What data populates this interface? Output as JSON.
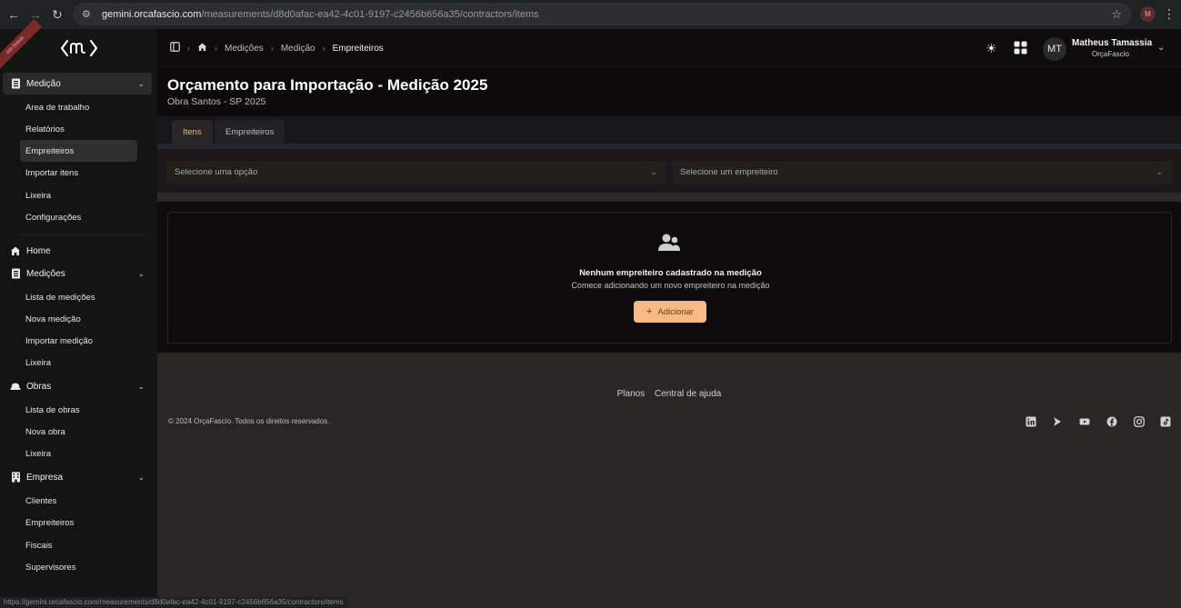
{
  "browser": {
    "url_host": "gemini.orcafascio.com",
    "url_path": "/measurements/d8d0afac-ea42-4c01-9197-c2456b656a35/contractors/items",
    "profile_initial": "M",
    "status_url": "https://gemini.orcafascio.com/measurements/d8d0afac-ea42-4c01-9197-c2456b656a35/contractors/items"
  },
  "sidebar": {
    "ribbon": "em breve",
    "sections": {
      "medicao": {
        "label": "Medição",
        "items": [
          "Area de trabalho",
          "Relatórios",
          "Empreiteiros",
          "Importar itens",
          "Lixeira",
          "Configurações"
        ]
      },
      "home": {
        "label": "Home"
      },
      "medicoes": {
        "label": "Medições",
        "items": [
          "Lista de medições",
          "Nova medição",
          "Importar medição",
          "Lixeira"
        ]
      },
      "obras": {
        "label": "Obras",
        "items": [
          "Lista de obras",
          "Nova obra",
          "Lixeira"
        ]
      },
      "empresa": {
        "label": "Empresa",
        "items": [
          "Clientes",
          "Empreiteiros",
          "Fiscais",
          "Supervisores"
        ]
      }
    }
  },
  "topbar": {
    "breadcrumb": [
      "Medições",
      "Medição",
      "Empreiteiros"
    ],
    "user": {
      "initials": "MT",
      "name": "Matheus Tamassia",
      "org": "OrçaFascio"
    }
  },
  "header": {
    "title": "Orçamento para Importação - Medição 2025",
    "subtitle": "Obra Santos - SP 2025"
  },
  "tabs": [
    {
      "label": "Itens",
      "active": true
    },
    {
      "label": "Empreiteiros",
      "active": false
    }
  ],
  "filters": {
    "option_placeholder": "Selecione uma opção",
    "contractor_placeholder": "Selecione um empreiteiro"
  },
  "empty_state": {
    "title": "Nenhum empreiteiro cadastrado na medição",
    "description": "Comece adicionando um novo empreiteiro na medição",
    "button_label": "Adicionar"
  },
  "footer": {
    "links": [
      "Planos",
      "Central de ajuda"
    ],
    "copyright": "© 2024 OrçaFascio. Todos os direitos reservados.",
    "social_icons": [
      "linkedin-icon",
      "play-icon",
      "youtube-icon",
      "facebook-icon",
      "instagram-icon",
      "tiktok-icon"
    ]
  },
  "colors": {
    "accent": "#f7b985",
    "active_tab_text": "#f2b07a"
  }
}
